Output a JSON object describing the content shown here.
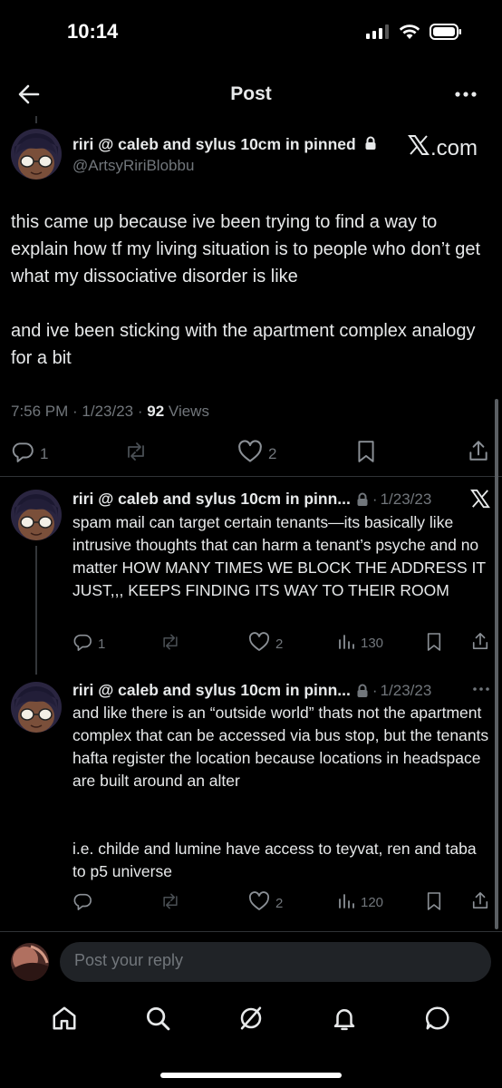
{
  "status_bar": {
    "time": "10:14"
  },
  "header": {
    "title": "Post"
  },
  "main_post": {
    "author_name": "riri @ caleb and sylus 10cm in pinned",
    "handle": "@ArtsyRiriBlobbu",
    "watermark": "X.com",
    "paragraph1": "this came up because ive been trying to find a way to explain how tf my living situation is to people who don’t get what my dissociative disorder is like",
    "paragraph2": "and ive been sticking with the apartment complex analogy for a bit",
    "time": "7:56 PM",
    "date": "1/23/23",
    "views_count": "92",
    "views_label": "Views",
    "replies": "1",
    "likes": "2"
  },
  "replies": [
    {
      "author_name": "riri @ caleb and sylus 10cm in pinn...",
      "date": "1/23/23",
      "text": "spam mail can target certain tenants—its basically like intrusive thoughts that can harm a tenant’s psyche and no matter HOW MANY TIMES WE BLOCK THE ADDRESS IT JUST,,, KEEPS FINDING ITS WAY TO THEIR ROOM",
      "replies": "1",
      "likes": "2",
      "views": "130"
    },
    {
      "author_name": "riri @ caleb and sylus 10cm in pinn...",
      "date": "1/23/23",
      "text": "and like there is an “outside world” thats not the apartment complex  that can be accessed via bus stop, but the tenants hafta register the location because locations in headspace are built around an alter",
      "text2": "i.e. childe and lumine have access to teyvat, ren and taba to p5 universe",
      "likes": "2",
      "views": "120"
    }
  ],
  "composer": {
    "placeholder": "Post your reply"
  }
}
